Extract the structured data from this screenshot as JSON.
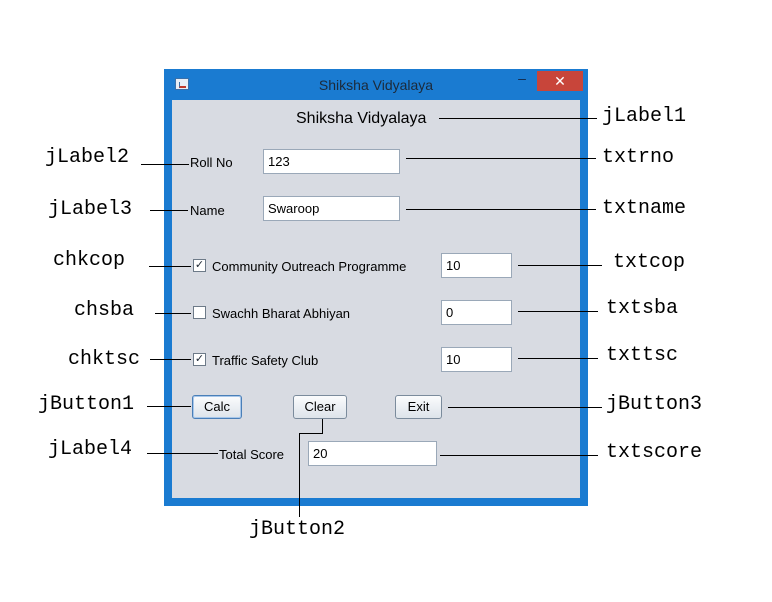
{
  "window": {
    "title": "Shiksha Vidyalaya",
    "minimize_glyph": "–",
    "close_glyph": "✕"
  },
  "form": {
    "heading": "Shiksha Vidyalaya",
    "roll_label": "Roll No",
    "roll_value": "123",
    "name_label": "Name",
    "name_value": "Swaroop",
    "cop_label": "Community Outreach Programme",
    "cop_checked": true,
    "cop_value": "10",
    "sba_label": "Swachh Bharat Abhiyan",
    "sba_checked": false,
    "sba_value": "0",
    "tsc_label": "Traffic Safety Club",
    "tsc_checked": true,
    "tsc_value": "10",
    "calc_label": "Calc",
    "clear_label": "Clear",
    "exit_label": "Exit",
    "total_label": "Total Score",
    "total_value": "20",
    "check_glyph": "✓"
  },
  "annotations": {
    "jLabel1": "jLabel1",
    "jLabel2": "jLabel2",
    "jLabel3": "jLabel3",
    "chkcop": "chkcop",
    "chsba": "chsba",
    "chktsc": "chktsc",
    "jButton1": "jButton1",
    "jLabel4": "jLabel4",
    "txtrno": "txtrno",
    "txtname": "txtname",
    "txtcop": "txtcop",
    "txtsba": "txtsba",
    "txttsc": "txttsc",
    "jButton3": "jButton3",
    "txtscore": "txtscore",
    "jButton2": "jButton2"
  },
  "colors": {
    "window_frame": "#1a7bd1",
    "client_bg": "#d8dbe2",
    "close_button": "#c8453a"
  }
}
